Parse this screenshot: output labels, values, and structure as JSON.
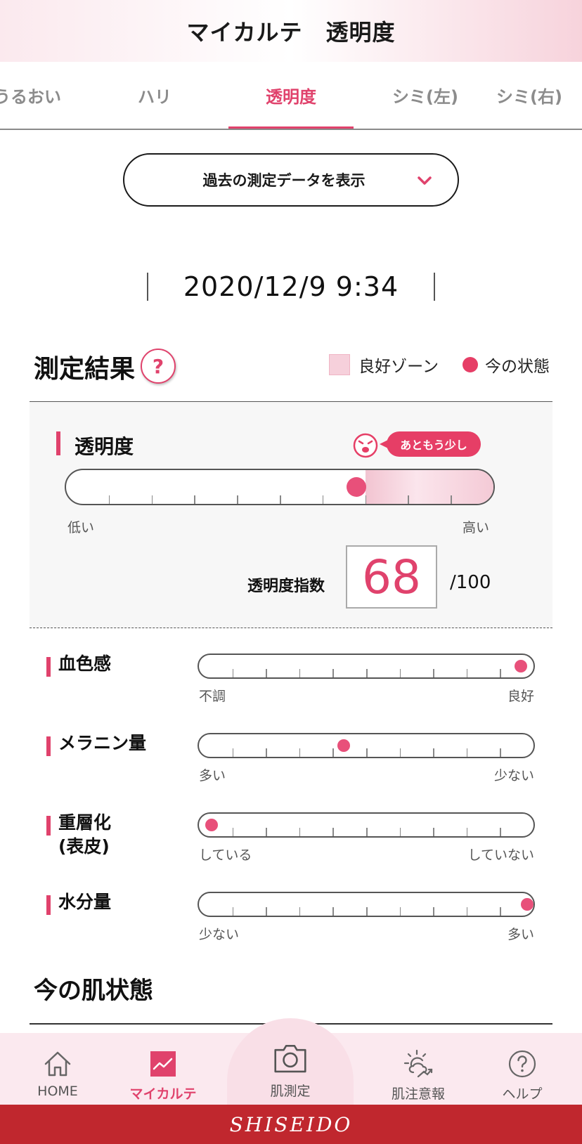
{
  "header": {
    "title": "マイカルテ　透明度"
  },
  "tabs": [
    {
      "label": "うるおい"
    },
    {
      "label": "ハリ"
    },
    {
      "label": "透明度"
    },
    {
      "label": "シミ(左)"
    },
    {
      "label": "シミ(右)"
    }
  ],
  "active_tab": 2,
  "past_data": {
    "label": "過去の測定データを表示",
    "icon": "chevron-down-icon"
  },
  "measurement": {
    "datetime": "2020/12/9 9:34"
  },
  "result": {
    "title": "測定結果",
    "help": "?",
    "legend": {
      "good_zone": "良好ゾーン",
      "current": "今の状態"
    }
  },
  "main_metric": {
    "label": "透明度",
    "advice": "あともう少し",
    "low_label": "低い",
    "high_label": "高い",
    "value_fraction": 0.68,
    "good_zone_from": 0.7,
    "score_label": "透明度指数",
    "score": "68",
    "score_max": "/100"
  },
  "sub_metrics": [
    {
      "label": "血色感",
      "left": "不調",
      "right": "良好",
      "value": 0.98
    },
    {
      "label": "メラニン量",
      "left": "多い",
      "right": "少ない",
      "value": 0.43
    },
    {
      "label": "重層化\n(表皮)",
      "left": "している",
      "right": "していない",
      "value": 0.02
    },
    {
      "label": "水分量",
      "left": "少ない",
      "right": "多い",
      "value": 1.0
    }
  ],
  "skin_state": {
    "title": "今の肌状態"
  },
  "bottom_nav": [
    {
      "label": "HOME",
      "icon": "home-icon"
    },
    {
      "label": "マイカルテ",
      "icon": "chart-icon"
    },
    {
      "label": "肌測定",
      "icon": "camera-icon"
    },
    {
      "label": "肌注意報",
      "icon": "weather-icon"
    },
    {
      "label": "ヘルプ",
      "icon": "help-icon"
    }
  ],
  "footer": {
    "brand": "SHISEIDO"
  },
  "colors": {
    "accent": "#e0426c",
    "dot": "#e8507a",
    "footer": "#c0272e",
    "zone": "#f6d0db"
  }
}
